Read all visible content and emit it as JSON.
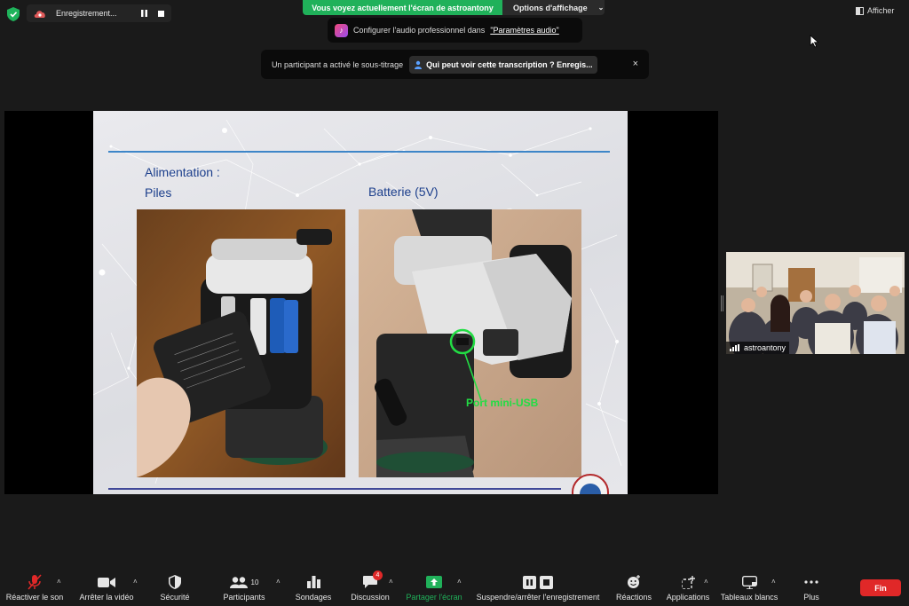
{
  "colors": {
    "share_green": "#20b15a",
    "end_red": "#e02828",
    "slide_title_blue": "#1c3f8c",
    "annotation_green": "#22dd44"
  },
  "recording": {
    "label": "Enregistrement...",
    "pause_icon": "pause-icon",
    "stop_icon": "stop-icon"
  },
  "share_banner": {
    "text": "Vous voyez actuellement l'écran de astroantony",
    "options_label": "Options d'affichage"
  },
  "afficher_label": "Afficher",
  "audio_toast": {
    "text": "Configurer l'audio professionnel dans",
    "link": "\"Paramètres audio\""
  },
  "caption_toast": {
    "text": "Un participant a activé le sous-titrage",
    "button": "Qui peut voir cette transcription ? Enregis...",
    "close": "×"
  },
  "slide": {
    "title_line1": "Alimentation :",
    "title_line2": "Piles",
    "right_title": "Batterie (5V)",
    "annotation": "Port mini-USB"
  },
  "participant": {
    "name": "astroantony"
  },
  "toolbar": {
    "mute": "Réactiver le son",
    "video": "Arrêter la vidéo",
    "security": "Sécurité",
    "participants": "Participants",
    "participants_count": "10",
    "polls": "Sondages",
    "chat": "Discussion",
    "chat_badge": "4",
    "share": "Partager l'écran",
    "record": "Suspendre/arrêter l'enregistrement",
    "reactions": "Réactions",
    "apps": "Applications",
    "whiteboards": "Tableaux blancs",
    "more": "Plus",
    "end": "Fin"
  }
}
